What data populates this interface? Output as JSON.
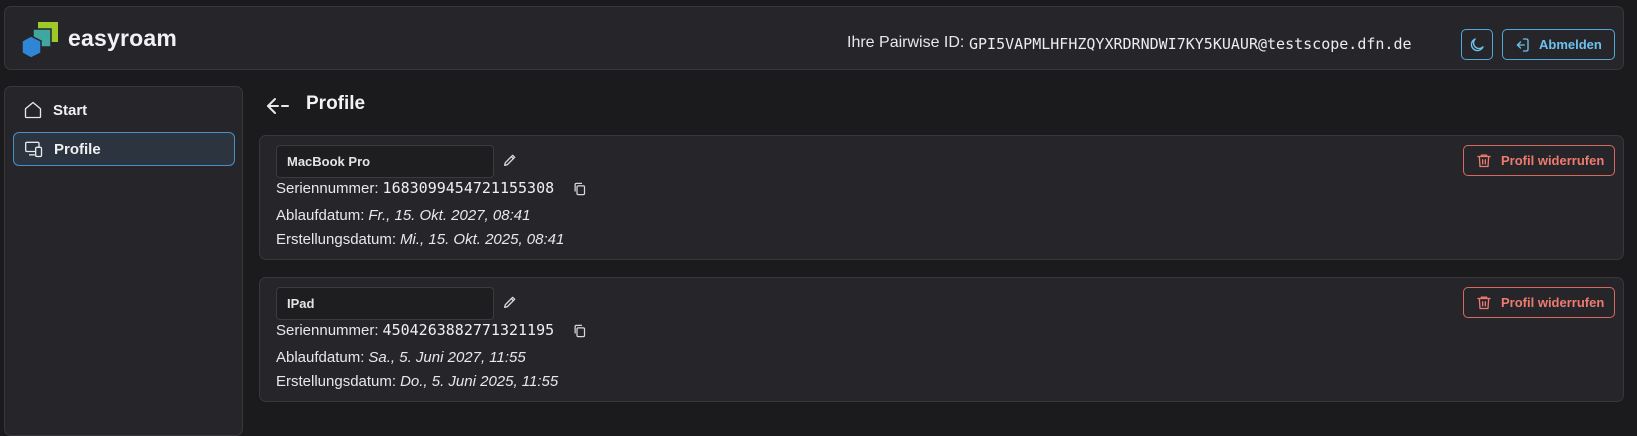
{
  "header": {
    "brand": "easyroam",
    "pairwise_label": "Ihre Pairwise ID:",
    "pairwise_id": "GPI5VAPMLHFHZQYXRDRNDWI7KY5KUAUR@testscope.dfn.de",
    "logout_label": "Abmelden"
  },
  "sidebar": {
    "items": [
      {
        "label": "Start",
        "icon": "home-icon",
        "active": false
      },
      {
        "label": "Profile",
        "icon": "devices-icon",
        "active": true
      }
    ]
  },
  "page": {
    "title": "Profile"
  },
  "profiles": [
    {
      "name": "MacBook Pro",
      "serial_label": "Seriennummer:",
      "serial": "1683099454721155308",
      "expiry_label": "Ablaufdatum:",
      "expiry": "Fr., 15. Okt. 2027, 08:41",
      "created_label": "Erstellungsdatum:",
      "created": "Mi., 15. Okt. 2025, 08:41",
      "revoke_label": "Profil widerrufen"
    },
    {
      "name": "IPad",
      "serial_label": "Seriennummer:",
      "serial": "4504263882771321195",
      "expiry_label": "Ablaufdatum:",
      "expiry": "Sa., 5. Juni 2027, 11:55",
      "created_label": "Erstellungsdatum:",
      "created": "Do., 5. Juni 2025, 11:55",
      "revoke_label": "Profil widerrufen"
    }
  ],
  "colors": {
    "accent": "#4fa8d8",
    "danger": "#ee7a70",
    "background": "#1b1b1e",
    "panel": "#26262a"
  }
}
